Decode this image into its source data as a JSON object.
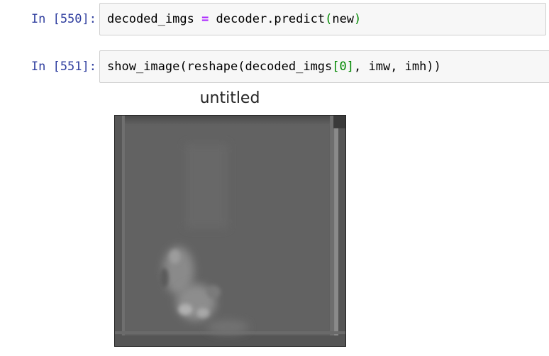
{
  "cells": [
    {
      "prompt": "In [550]:",
      "code_tokens": [
        {
          "text": "decoded_imgs ",
          "cls": ""
        },
        {
          "text": "=",
          "cls": "tok-op"
        },
        {
          "text": " decoder.predict",
          "cls": ""
        },
        {
          "text": "(",
          "cls": "tok-green"
        },
        {
          "text": "new",
          "cls": ""
        },
        {
          "text": ")",
          "cls": "tok-green"
        }
      ]
    },
    {
      "prompt": "In [551]:",
      "code_tokens": [
        {
          "text": "show_image(reshape(decoded_imgs",
          "cls": ""
        },
        {
          "text": "[",
          "cls": "tok-green"
        },
        {
          "text": "0",
          "cls": "tok-num"
        },
        {
          "text": "]",
          "cls": "tok-green"
        },
        {
          "text": ", imw, imh))",
          "cls": ""
        }
      ]
    }
  ],
  "output": {
    "figure_title": "untitled",
    "image_description_icon": "decoded-grayscale-image"
  }
}
